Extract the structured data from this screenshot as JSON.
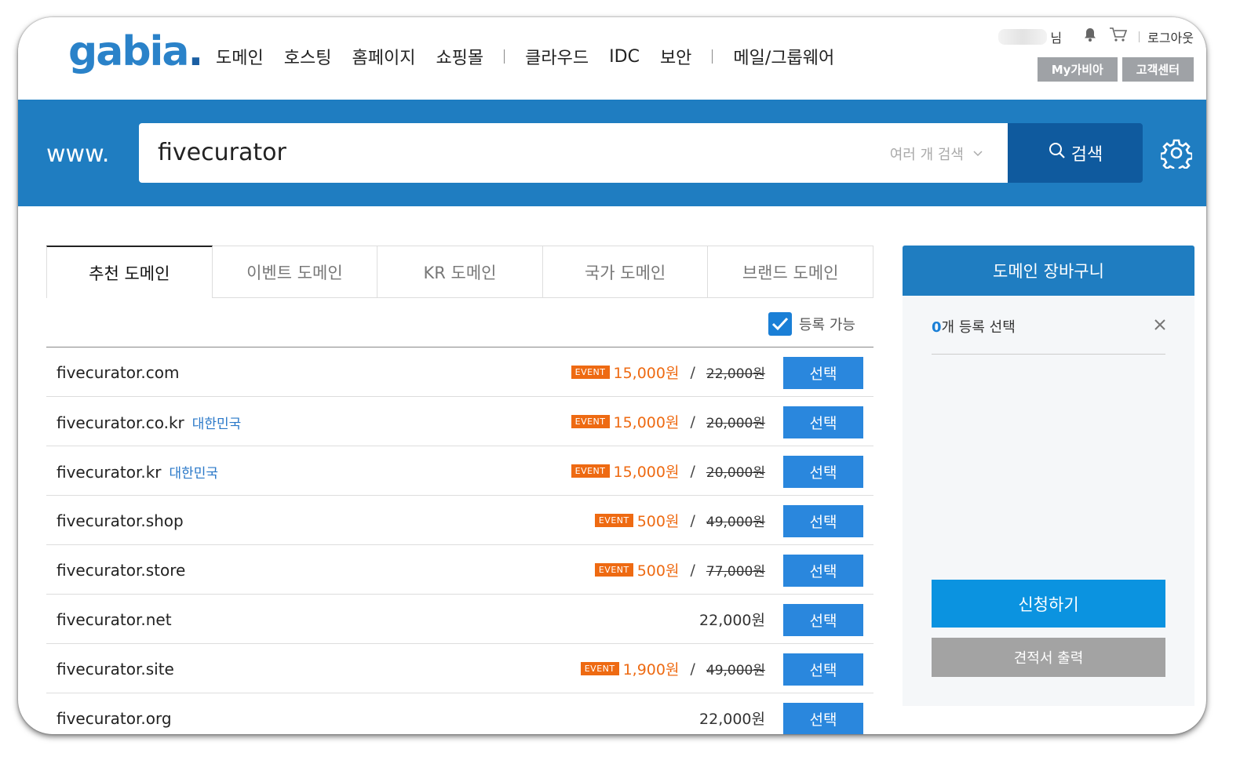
{
  "header": {
    "logo": "gabia",
    "logo_dot": ".",
    "nav": [
      "도메인",
      "호스팅",
      "홈페이지",
      "쇼핑몰",
      "클라우드",
      "IDC",
      "보안",
      "메일/그룹웨어"
    ],
    "user_suffix": "님",
    "logout": "로그아웃",
    "buttons": {
      "my": "My가비아",
      "support": "고객센터"
    }
  },
  "search": {
    "prefix": "www.",
    "value": "fivecurator",
    "multi_label": "여러 개 검색",
    "button": "검색"
  },
  "tabs": [
    "추천 도메인",
    "이벤트 도메인",
    "KR 도메인",
    "국가 도메인",
    "브랜드 도메인"
  ],
  "filter": {
    "available_label": "등록 가능",
    "checked": true
  },
  "domains": [
    {
      "name": "fivecurator.com",
      "country": "",
      "event": "EVENT",
      "event_price": "15,000원",
      "original": "22,000원",
      "select": "선택"
    },
    {
      "name": "fivecurator.co.kr",
      "country": "대한민국",
      "event": "EVENT",
      "event_price": "15,000원",
      "original": "20,000원",
      "select": "선택"
    },
    {
      "name": "fivecurator.kr",
      "country": "대한민국",
      "event": "EVENT",
      "event_price": "15,000원",
      "original": "20,000원",
      "select": "선택"
    },
    {
      "name": "fivecurator.shop",
      "country": "",
      "event": "EVENT",
      "event_price": "500원",
      "original": "49,000원",
      "select": "선택"
    },
    {
      "name": "fivecurator.store",
      "country": "",
      "event": "EVENT",
      "event_price": "500원",
      "original": "77,000원",
      "select": "선택"
    },
    {
      "name": "fivecurator.net",
      "country": "",
      "event": "",
      "event_price": "",
      "original": "",
      "price": "22,000원",
      "select": "선택"
    },
    {
      "name": "fivecurator.site",
      "country": "",
      "event": "EVENT",
      "event_price": "1,900원",
      "original": "49,000원",
      "select": "선택"
    },
    {
      "name": "fivecurator.org",
      "country": "",
      "event": "",
      "event_price": "",
      "original": "",
      "price": "22,000원",
      "select": "선택"
    }
  ],
  "cart": {
    "title": "도메인 장바구니",
    "count": "0",
    "count_suffix": "개 등록 선택",
    "apply": "신청하기",
    "quote": "견적서 출력"
  },
  "colors": {
    "brand_blue": "#1f7dc1",
    "search_btn": "#0f5a9e",
    "event_orange": "#ee6a12",
    "select_btn": "#2a87dd"
  }
}
